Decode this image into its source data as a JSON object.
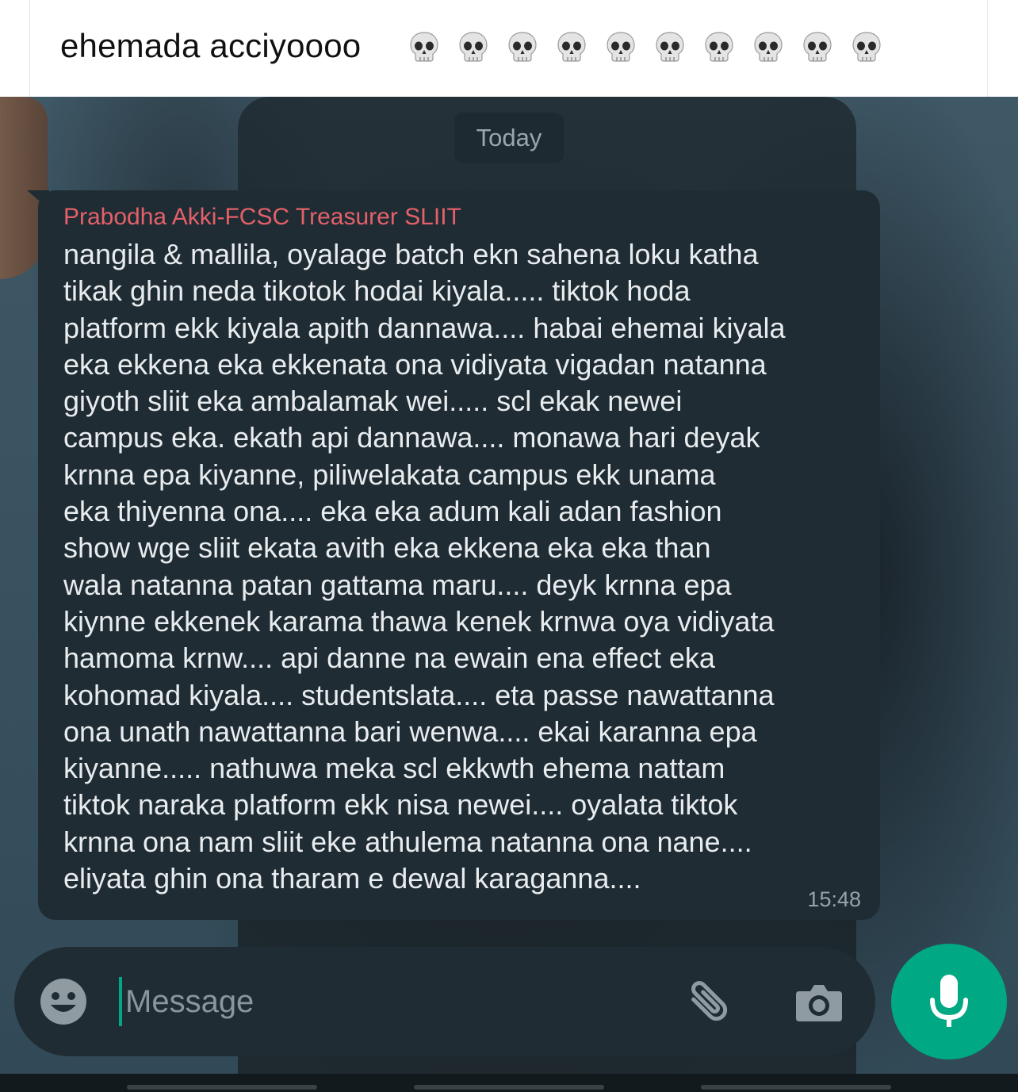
{
  "caption": {
    "text": "ehemada acciyoooo",
    "skull_count": 10,
    "skull_icon": "skull-icon"
  },
  "chat": {
    "date_chip": "Today",
    "message": {
      "sender": "Prabodha Akki-FCSC Treasurer SLIIT",
      "lines": [
        "nangila & mallila, oyalage batch ekn sahena loku katha",
        "tikak ghin neda tikotok hodai kiyala..... tiktok hoda",
        "platform ekk kiyala apith dannawa.... habai ehemai kiyala",
        "eka ekkena eka ekkenata ona vidiyata vigadan natanna",
        "giyoth sliit eka ambalamak wei..... scl ekak newei",
        "campus eka. ekath api dannawa.... monawa hari deyak",
        "krnna epa kiyanne, piliwelakata campus ekk unama",
        "eka thiyenna ona.... eka eka adum kali adan fashion",
        "show wge sliit ekata avith eka ekkena eka eka than",
        "wala natanna patan gattama maru.... deyk krnna epa",
        "kiynne ekkenek karama thawa kenek krnwa oya vidiyata",
        "hamoma krnw.... api danne na ewain ena effect eka",
        "kohomad kiyala.... studentslata.... eta passe nawattanna",
        "ona unath nawattanna bari wenwa.... ekai karanna epa",
        "kiyanne..... nathuwa meka scl ekkwth ehema nattam",
        "tiktok naraka platform ekk nisa newei.... oyalata tiktok",
        "krnna ona nam sliit eke athulema natanna ona nane....",
        "eliyata ghin ona tharam e dewal karaganna...."
      ],
      "time": "15:48"
    }
  },
  "input_bar": {
    "placeholder": "Message",
    "value": "",
    "emoji_icon": "smiley-icon",
    "attach_icon": "paperclip-icon",
    "camera_icon": "camera-icon",
    "mic_icon": "microphone-icon"
  },
  "colors": {
    "sender": "#e5606a",
    "bubble": "#1f2c33",
    "accent": "#00a884",
    "text": "#e8ecee",
    "muted": "#97a3aa"
  }
}
